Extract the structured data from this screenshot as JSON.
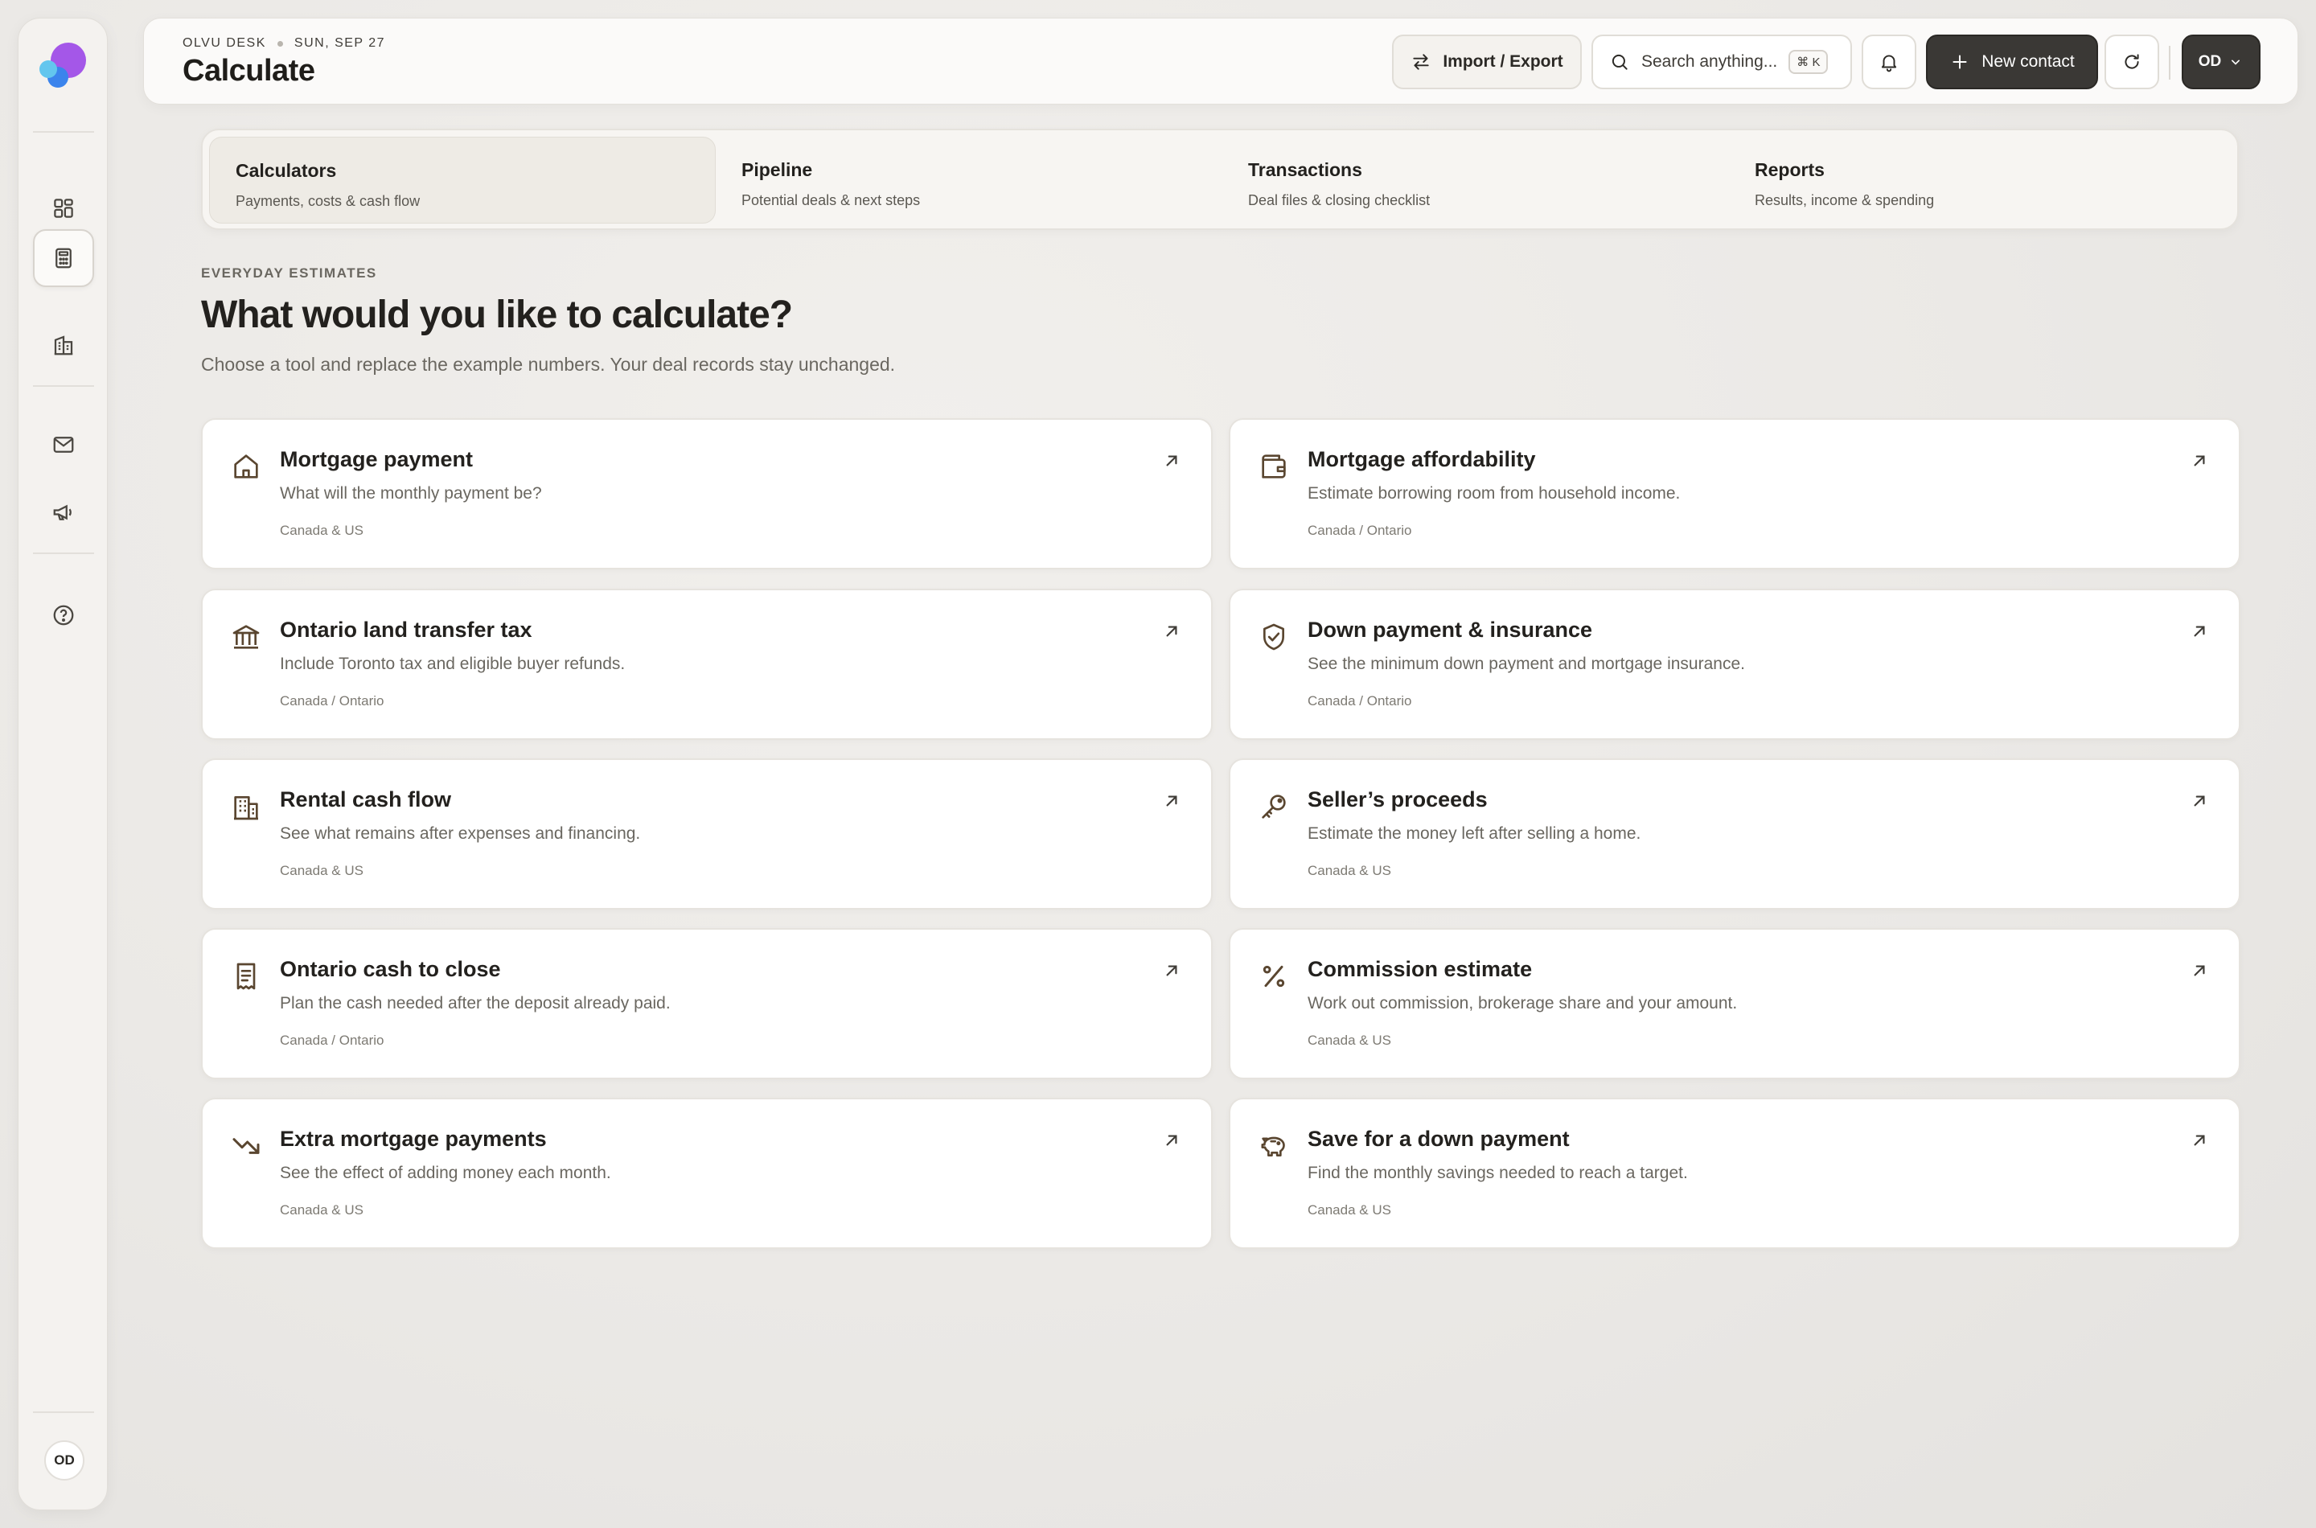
{
  "sidebar": {
    "items": [
      {
        "icon": "dashboard-grid-icon"
      },
      {
        "icon": "calculator-icon",
        "active": true
      },
      {
        "icon": "building-icon"
      },
      {
        "icon": "mail-icon"
      },
      {
        "icon": "megaphone-icon"
      },
      {
        "icon": "help-circle-icon"
      }
    ],
    "avatar": "OD"
  },
  "header": {
    "workspace": "OLVU DESK",
    "date": "SUN, SEP 27",
    "title": "Calculate",
    "import_export_label": "Import / Export",
    "search_placeholder": "Search anything...",
    "search_shortcut": "⌘ K",
    "new_contact_label": "New contact",
    "user_initials": "OD"
  },
  "tabs": [
    {
      "title": "Calculators",
      "subtitle": "Payments, costs & cash flow",
      "active": true
    },
    {
      "title": "Pipeline",
      "subtitle": "Potential deals & next steps"
    },
    {
      "title": "Transactions",
      "subtitle": "Deal files & closing checklist"
    },
    {
      "title": "Reports",
      "subtitle": "Results, income & spending"
    }
  ],
  "intro": {
    "eyebrow": "EVERYDAY ESTIMATES",
    "title": "What would you like to calculate?",
    "lead": "Choose a tool and replace the example numbers. Your deal records stay unchanged."
  },
  "cards": [
    {
      "title": "Mortgage payment",
      "desc": "What will the monthly payment be?",
      "region": "Canada & US",
      "icon": "home-icon"
    },
    {
      "title": "Mortgage affordability",
      "desc": "Estimate borrowing room from household income.",
      "region": "Canada / Ontario",
      "icon": "wallet-icon"
    },
    {
      "title": "Ontario land transfer tax",
      "desc": "Include Toronto tax and eligible buyer refunds.",
      "region": "Canada / Ontario",
      "icon": "bank-icon"
    },
    {
      "title": "Down payment & insurance",
      "desc": "See the minimum down payment and mortgage insurance.",
      "region": "Canada / Ontario",
      "icon": "shield-check-icon"
    },
    {
      "title": "Rental cash flow",
      "desc": "See what remains after expenses and financing.",
      "region": "Canada & US",
      "icon": "apartment-icon"
    },
    {
      "title": "Seller’s proceeds",
      "desc": "Estimate the money left after selling a home.",
      "region": "Canada & US",
      "icon": "key-icon"
    },
    {
      "title": "Ontario cash to close",
      "desc": "Plan the cash needed after the deposit already paid.",
      "region": "Canada / Ontario",
      "icon": "receipt-icon"
    },
    {
      "title": "Commission estimate",
      "desc": "Work out commission, brokerage share and your amount.",
      "region": "Canada & US",
      "icon": "percent-icon"
    },
    {
      "title": "Extra mortgage payments",
      "desc": "See the effect of adding money each month.",
      "region": "Canada & US",
      "icon": "trending-down-icon"
    },
    {
      "title": "Save for a down payment",
      "desc": "Find the monthly savings needed to reach a target.",
      "region": "Canada & US",
      "icon": "piggy-bank-icon"
    }
  ]
}
